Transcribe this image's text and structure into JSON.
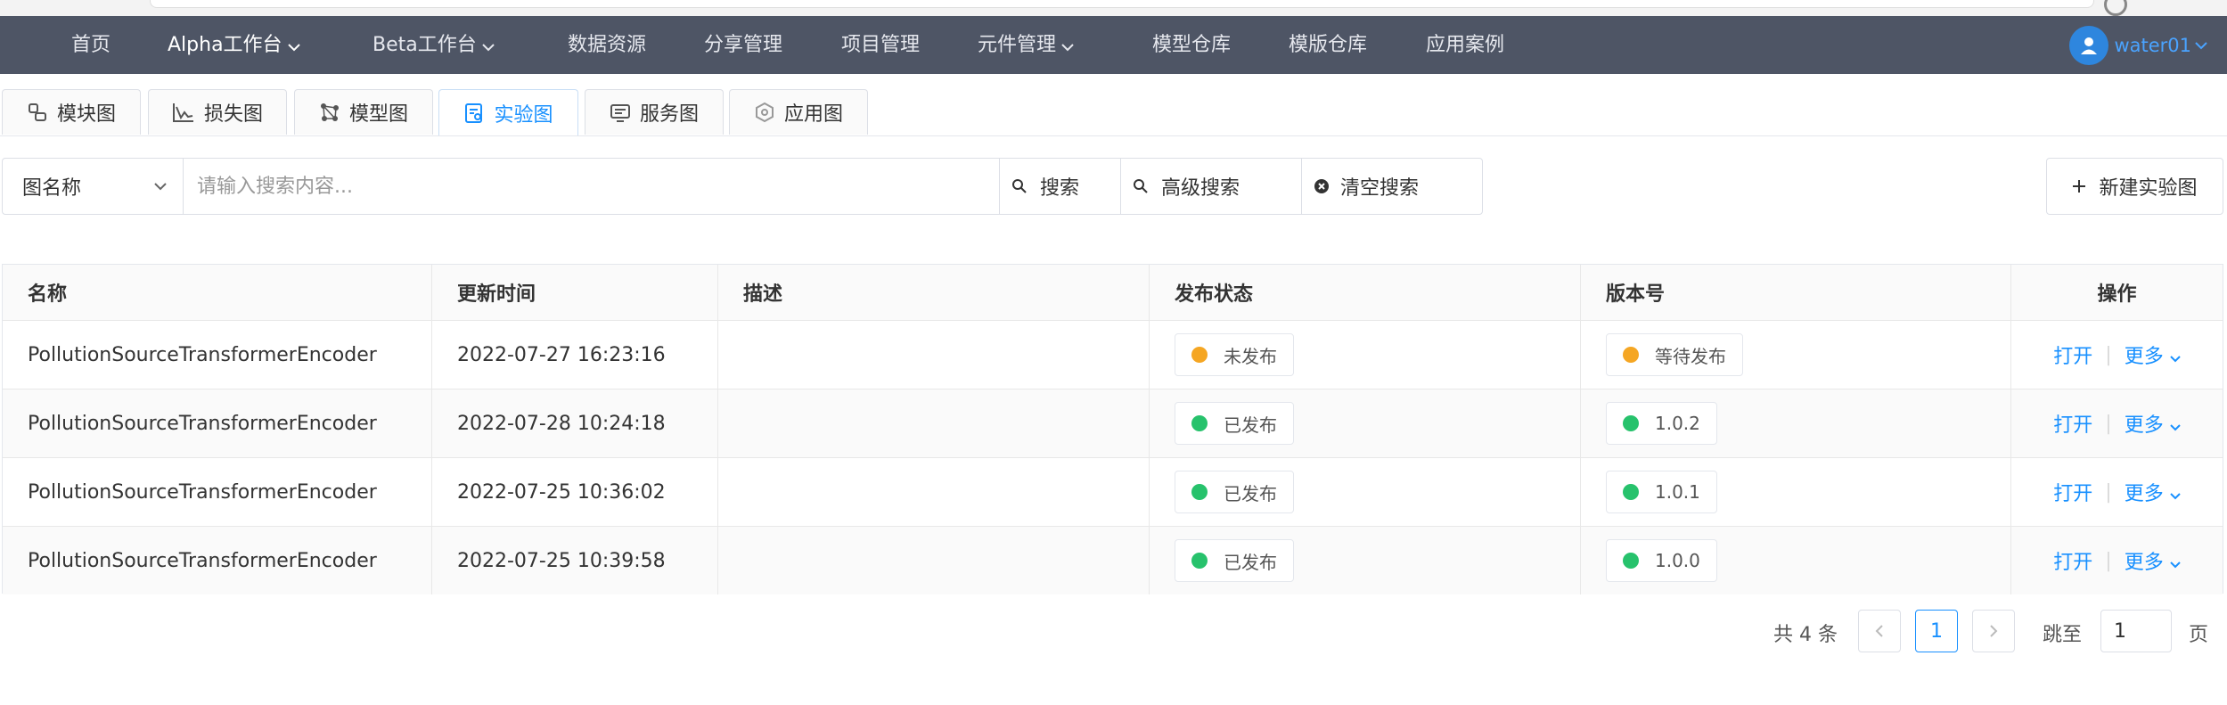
{
  "nav": {
    "items": [
      {
        "label": "首页"
      },
      {
        "label": "Alpha工作台"
      },
      {
        "label": "Beta工作台"
      },
      {
        "label": "数据资源"
      },
      {
        "label": "分享管理"
      },
      {
        "label": "项目管理"
      },
      {
        "label": "元件管理"
      },
      {
        "label": "模型仓库"
      },
      {
        "label": "模版仓库"
      },
      {
        "label": "应用案例"
      }
    ],
    "active": "Alpha工作台",
    "user": "water01"
  },
  "tabs": [
    {
      "label": "模块图",
      "icon": "module-graph-icon"
    },
    {
      "label": "损失图",
      "icon": "loss-chart-icon"
    },
    {
      "label": "模型图",
      "icon": "model-graph-icon"
    },
    {
      "label": "实验图",
      "icon": "experiment-graph-icon",
      "active": true
    },
    {
      "label": "服务图",
      "icon": "service-graph-icon"
    },
    {
      "label": "应用图",
      "icon": "application-graph-icon"
    }
  ],
  "search": {
    "field_select": "图名称",
    "placeholder": "请输入搜索内容...",
    "search_label": "搜索",
    "advanced_label": "高级搜索",
    "clear_label": "清空搜索",
    "new_label": "新建实验图"
  },
  "table": {
    "headers": {
      "name": "名称",
      "updated": "更新时间",
      "desc": "描述",
      "status": "发布状态",
      "version": "版本号",
      "ops": "操作"
    },
    "rows": [
      {
        "name": "PollutionSourceTransformerEncoder",
        "updated": "2022-07-27 16:23:16",
        "desc": "",
        "status": "未发布",
        "status_color": "#f5a623",
        "version": "等待发布",
        "version_color": "#f5a623"
      },
      {
        "name": "PollutionSourceTransformerEncoder",
        "updated": "2022-07-28 10:24:18",
        "desc": "",
        "status": "已发布",
        "status_color": "#27c26c",
        "version": "1.0.2",
        "version_color": "#27c26c"
      },
      {
        "name": "PollutionSourceTransformerEncoder",
        "updated": "2022-07-25 10:36:02",
        "desc": "",
        "status": "已发布",
        "status_color": "#27c26c",
        "version": "1.0.1",
        "version_color": "#27c26c"
      },
      {
        "name": "PollutionSourceTransformerEncoder",
        "updated": "2022-07-25 10:39:58",
        "desc": "",
        "status": "已发布",
        "status_color": "#27c26c",
        "version": "1.0.0",
        "version_color": "#27c26c"
      }
    ],
    "open_label": "打开",
    "more_label": "更多"
  },
  "pagination": {
    "total": "共 4 条",
    "current": "1",
    "jump_label": "跳至",
    "jump_value": "1",
    "page_unit": "页"
  },
  "colors": {
    "nav_bg": "#4e5565",
    "accent": "#1890ff",
    "pending": "#f5a623",
    "published": "#27c26c"
  }
}
